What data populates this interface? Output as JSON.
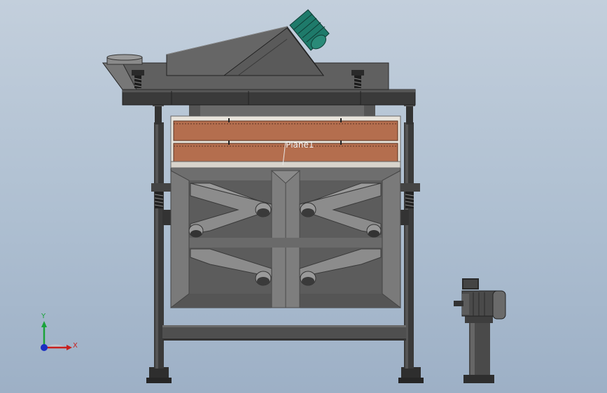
{
  "viewport": {
    "background_top": "#c3cfdc",
    "background_bottom": "#9db0c6"
  },
  "model": {
    "plane_label": "Plane1",
    "colors": {
      "steel_dark": "#2e2e2e",
      "steel_mid": "#5c5c5c",
      "steel_light": "#7a7a7a",
      "panel_copper": "#b46e4e",
      "motor_green": "#1e7a6a"
    }
  },
  "triad": {
    "x_label": "X",
    "y_label": "Y",
    "x_color": "#c8201e",
    "y_color": "#1aa33a",
    "z_color": "#1b2fc2"
  }
}
